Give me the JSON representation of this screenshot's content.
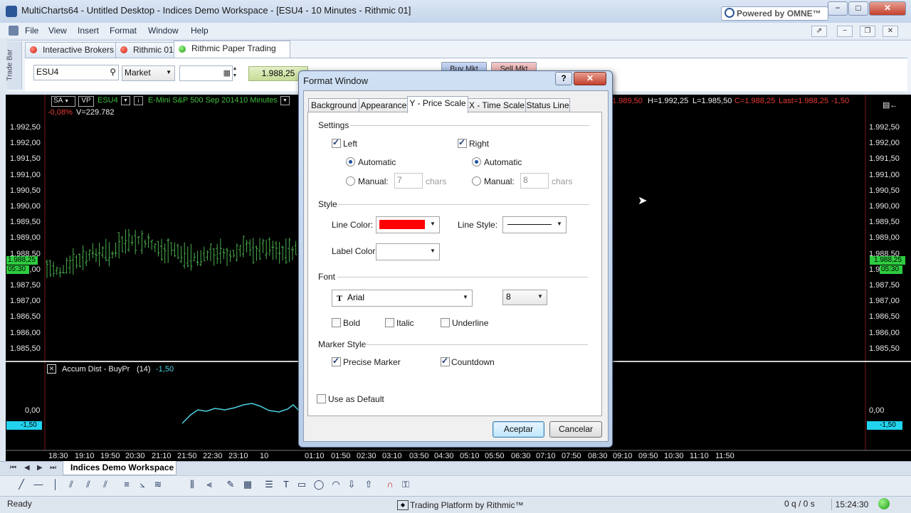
{
  "window": {
    "title": "MultiCharts64 - Untitled Desktop - Indices Demo Workspace - [ESU4 - 10 Minutes - Rithmic 01]",
    "powered": "Powered by OMNE™",
    "buttons": [
      "−",
      "□",
      "✕"
    ]
  },
  "menu": {
    "items": [
      "File",
      "View",
      "Insert",
      "Format",
      "Window",
      "Help"
    ],
    "mdi_buttons": [
      "⇗",
      "−",
      "❐",
      "✕"
    ]
  },
  "tradebar": {
    "side_label": "Trade Bar",
    "tabs": [
      {
        "label": "Interactive Brokers",
        "status": "red"
      },
      {
        "label": "Rithmic 01",
        "status": "red"
      },
      {
        "label": "Rithmic Paper Trading",
        "status": "green"
      }
    ],
    "symbol": "ESU4",
    "order_type": "Market",
    "price": "1.988,25",
    "buy_label": "Buy Mkt",
    "sell_label": "Sell Mkt"
  },
  "chart": {
    "header": {
      "sa": "SA",
      "vp": "VP",
      "symbol": "ESU4",
      "description": "E-Mini S&P 500 Sep 2014",
      "interval": "10 Minutes",
      "change": "-0,08%",
      "volume": "V=229.782",
      "ohlc_h": "H=1.992,25",
      "ohlc_l": "L=1.985,50",
      "ohlc_c": "C=1.988,25",
      "last": "Last=1.988,25",
      "net": "-1,50",
      "o_partial": "1.989,50"
    },
    "price_ticks": [
      "1.992,50",
      "1.992,00",
      "1.991,50",
      "1.991,00",
      "1.990,50",
      "1.990,00",
      "1.989,50",
      "1.989,00",
      "1.988,50",
      "1.988,00",
      "1.987,50",
      "1.987,00",
      "1.986,50",
      "1.986,00",
      "1.985,50"
    ],
    "last_price_marker": "1.988,25",
    "countdown_marker": "05:30",
    "time_ticks": [
      "18:30",
      "19:10",
      "19:50",
      "20:30",
      "21:10",
      "21:50",
      "22:30",
      "23:10",
      "10",
      "01:10",
      "01:50",
      "02:30",
      "03:10",
      "03:50",
      "04:30",
      "05:10",
      "05:50",
      "06:30",
      "07:10",
      "07:50",
      "08:30",
      "09:10",
      "09:50",
      "10:30",
      "11:10",
      "11:50"
    ],
    "indicator": {
      "name": "Accum Dist - BuyPr",
      "param": "(14)",
      "value": "-1,50",
      "zero_label": "0,00",
      "marker": "-1,50"
    },
    "colors": {
      "bars": "#4caf50",
      "indicator": "#4dd0e1",
      "background": "#000000",
      "marker": "#2ecc40"
    }
  },
  "workspace_tab": "Indices Demo Workspace",
  "status": {
    "left": "Ready",
    "center": "Trading Platform by Rithmic™",
    "queue": "0 q / 0 s",
    "time": "15:24:30"
  },
  "dialog": {
    "title": "Format Window",
    "help_button": "?",
    "close_button": "✕",
    "tabs": [
      "Background",
      "Appearance",
      "Y - Price Scale",
      "X - Time Scale",
      "Status Line"
    ],
    "active_tab": "Y - Price Scale",
    "settings": {
      "group": "Settings",
      "left": {
        "label": "Left",
        "checked": true,
        "automatic": "Automatic",
        "manual": "Manual:",
        "chars_value": "7",
        "chars_unit": "chars"
      },
      "right": {
        "label": "Right",
        "checked": true,
        "automatic": "Automatic",
        "manual": "Manual:",
        "chars_value": "8",
        "chars_unit": "chars"
      }
    },
    "style": {
      "group": "Style",
      "line_color_label": "Line Color:",
      "line_color": "#ff0000",
      "line_style_label": "Line Style:",
      "label_color_label": "Label Color:"
    },
    "font": {
      "group": "Font",
      "face": "Arial",
      "size": "8",
      "bold": "Bold",
      "italic": "Italic",
      "underline": "Underline"
    },
    "marker": {
      "group": "Marker Style",
      "precise": "Precise Marker",
      "countdown": "Countdown"
    },
    "use_default": "Use as Default",
    "ok": "Aceptar",
    "cancel": "Cancelar"
  }
}
